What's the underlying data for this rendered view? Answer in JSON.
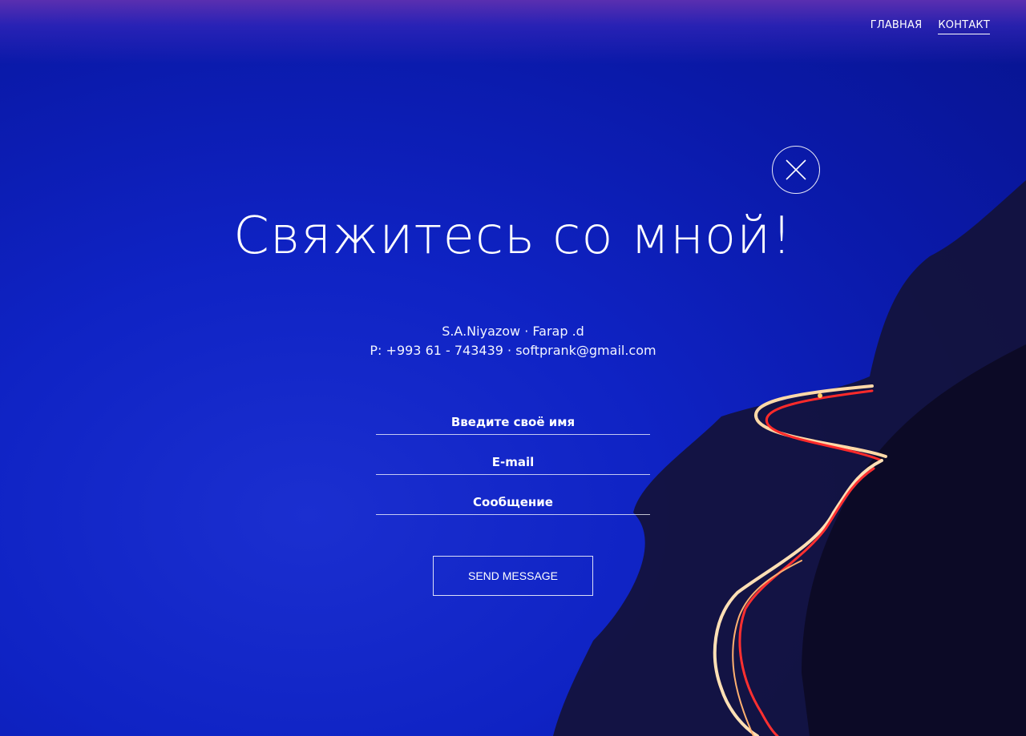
{
  "nav": {
    "items": [
      {
        "label": "ГЛАВНАЯ"
      },
      {
        "label": "КОНТАКТ"
      }
    ]
  },
  "header": {
    "title": "Свяжитесь со мной!"
  },
  "contact": {
    "line1": "S.A.Niyazow · Farap .d",
    "line2": "P: +993 61 - 743439 · softprank@gmail.com"
  },
  "form": {
    "name_placeholder": "Введите своё имя",
    "email_placeholder": "E-mail",
    "message_placeholder": "Сообщение",
    "send_label": "SEND MESSAGE"
  },
  "icons": {
    "close": "close-icon"
  },
  "colors": {
    "background": "#0f23c4",
    "text": "#ffffff"
  }
}
